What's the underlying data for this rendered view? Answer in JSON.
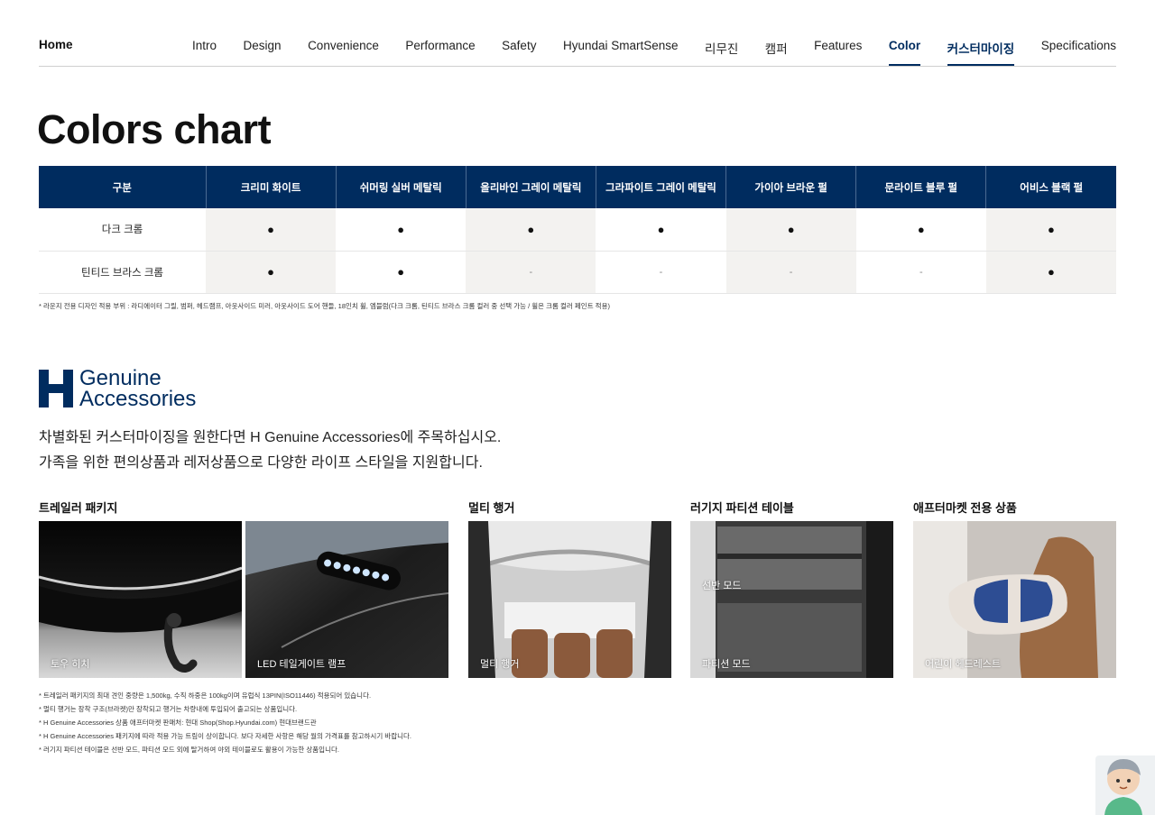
{
  "nav": {
    "home": "Home",
    "items": [
      {
        "label": "Intro",
        "active": false
      },
      {
        "label": "Design",
        "active": false
      },
      {
        "label": "Convenience",
        "active": false
      },
      {
        "label": "Performance",
        "active": false
      },
      {
        "label": "Safety",
        "active": false
      },
      {
        "label": "Hyundai SmartSense",
        "active": false
      },
      {
        "label": "리무진",
        "active": false
      },
      {
        "label": "캠퍼",
        "active": false
      },
      {
        "label": "Features",
        "active": false
      },
      {
        "label": "Color",
        "active": true
      },
      {
        "label": "커스터마이징",
        "active": true
      },
      {
        "label": "Specifications",
        "active": false
      }
    ]
  },
  "colors_chart": {
    "title": "Colors chart",
    "headers": [
      "구분",
      "크리미 화이트",
      "쉬머링 실버 메탈릭",
      "올리바인 그레이 메탈릭",
      "그라파이트 그레이 메탈릭",
      "가이아 브라운 펄",
      "문라이트 블루 펄",
      "어비스 블랙 펄"
    ],
    "rows": [
      {
        "label": "다크 크롬",
        "cells": [
          "●",
          "●",
          "●",
          "●",
          "●",
          "●",
          "●"
        ]
      },
      {
        "label": "틴티드 브라스 크롬",
        "cells": [
          "●",
          "●",
          "-",
          "-",
          "-",
          "-",
          "●"
        ]
      }
    ],
    "note": "* 라운지 전용 디자인 적용 부위 : 라디에이터 그릴, 범퍼, 헤드램프, 아웃사이드 미러, 아웃사이드 도어 핸들, 18인치 휠, 엠블럼(다크 크롬, 틴티드 브라스 크롬 컬러 중 선택 가능 / 휠은 크롬 컬러 페인트 적용)"
  },
  "genuine": {
    "logo_line1": "Genuine",
    "logo_line2": "Accessories",
    "brand_color": "#002c5f",
    "intro_line1": "차별화된 커스터마이징을 원한다면 H Genuine Accessories에 주목하십시오.",
    "intro_line2": "가족을 위한 편의상품과 레저상품으로 다양한 라이프 스타일을 지원합니다."
  },
  "categories": {
    "trailer": {
      "title": "트레일러 패키지",
      "items": [
        "토우 히치",
        "LED 테일게이트 램프"
      ]
    },
    "hanger": {
      "title": "멀티 행거",
      "items": [
        "멀티 행거"
      ]
    },
    "luggage": {
      "title": "러기지 파티션 테이블",
      "items": [
        "선반 모드",
        "파티션 모드"
      ]
    },
    "aftermarket": {
      "title": "애프터마켓 전용 상품",
      "items": [
        "어린이 헤드레스트"
      ]
    }
  },
  "notes": [
    "* 트레일러 패키지의 최대 견인 중량은 1,500kg, 수직 하중은 100kg이며 유럽식 13PIN(ISO11446) 적용되어 있습니다.",
    "* 멀티 행거는 장착 구조(브라켓)만 장착되고 행거는 차량내에 투입되어 출고되는 상품입니다.",
    "* H Genuine Accessories 상품 애프터마켓 판매처: 현대 Shop(Shop.Hyundai.com) 현대브랜드관",
    "* H Genuine Accessories 패키지에 따라 적용 가능 트림이 상이합니다. 보다 자세한 사항은 해당 월의 가격표를 참고하시기 바랍니다.",
    "* 러기지 파티션 테이블은 선반 모드, 파티션 모드 외에 탈거하여 야외 테이블로도 활용이 가능한 상품입니다."
  ]
}
